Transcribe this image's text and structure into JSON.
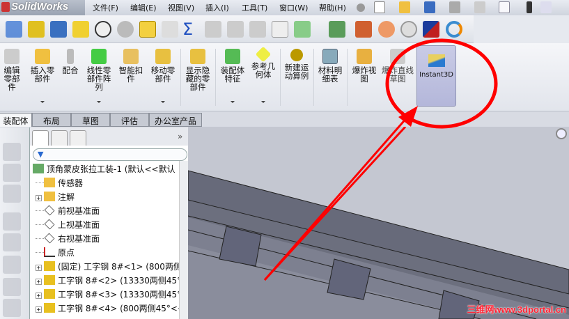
{
  "app": {
    "title": "SolidWorks"
  },
  "menu": [
    "文件(F)",
    "编辑(E)",
    "视图(V)",
    "插入(I)",
    "工具(T)",
    "窗口(W)",
    "帮助(H)"
  ],
  "ribbon": [
    {
      "label": "编辑零部件",
      "icon": "edit-component-icon"
    },
    {
      "label": "插入零部件",
      "icon": "insert-component-icon",
      "dropdown": true
    },
    {
      "label": "配合",
      "icon": "mate-icon"
    },
    {
      "label": "线性零部件阵列",
      "icon": "linear-pattern-icon",
      "dropdown": true
    },
    {
      "label": "智能扣件",
      "icon": "smart-fastener-icon"
    },
    {
      "label": "移动零部件",
      "icon": "move-component-icon",
      "dropdown": true
    },
    {
      "label": "显示隐藏的零部件",
      "icon": "show-hidden-icon"
    },
    {
      "label": "装配体特征",
      "icon": "assembly-feature-icon",
      "dropdown": true
    },
    {
      "label": "参考几何体",
      "icon": "reference-geometry-icon",
      "dropdown": true
    },
    {
      "label": "新建运动算例",
      "icon": "motion-study-icon"
    },
    {
      "label": "材料明细表",
      "icon": "bom-icon"
    },
    {
      "label": "爆炸视图",
      "icon": "exploded-view-icon"
    },
    {
      "label": "爆炸直线草图",
      "icon": "explode-line-sketch-icon"
    },
    {
      "label": "Instant3D",
      "icon": "instant3d-icon",
      "active": true
    }
  ],
  "tabs": [
    "装配体",
    "布局",
    "草图",
    "评估",
    "办公室产品"
  ],
  "tree": [
    {
      "label": "顶角蒙皮张拉工装-1  (默认<<默认",
      "icon": "assembly-icon",
      "level": 0
    },
    {
      "label": "传感器",
      "icon": "sensor-folder-icon",
      "level": 1
    },
    {
      "label": "注解",
      "icon": "annotation-icon",
      "level": 1,
      "expand": true
    },
    {
      "label": "前视基准面",
      "icon": "plane-icon",
      "level": 1
    },
    {
      "label": "上视基准面",
      "icon": "plane-icon",
      "level": 1
    },
    {
      "label": "右视基准面",
      "icon": "plane-icon",
      "level": 1
    },
    {
      "label": "原点",
      "icon": "origin-icon",
      "level": 1
    },
    {
      "label": "(固定) 工字钢 8#<1> (800两侧",
      "icon": "part-icon",
      "level": 1,
      "expand": true
    },
    {
      "label": "工字钢 8#<2> (13330两侧45°",
      "icon": "part-icon",
      "level": 1,
      "expand": true
    },
    {
      "label": "工字钢 8#<3> (13330两侧45°",
      "icon": "part-icon",
      "level": 1,
      "expand": true
    },
    {
      "label": "工字钢 8#<4> (800两侧45°<<",
      "icon": "part-icon",
      "level": 1,
      "expand": true
    }
  ],
  "panel": {
    "expand_label": "»"
  },
  "watermark": "三维网www.3dportal.cn",
  "colors": {
    "annotation": "#ff0000",
    "active_button": "#b8bbdc"
  }
}
